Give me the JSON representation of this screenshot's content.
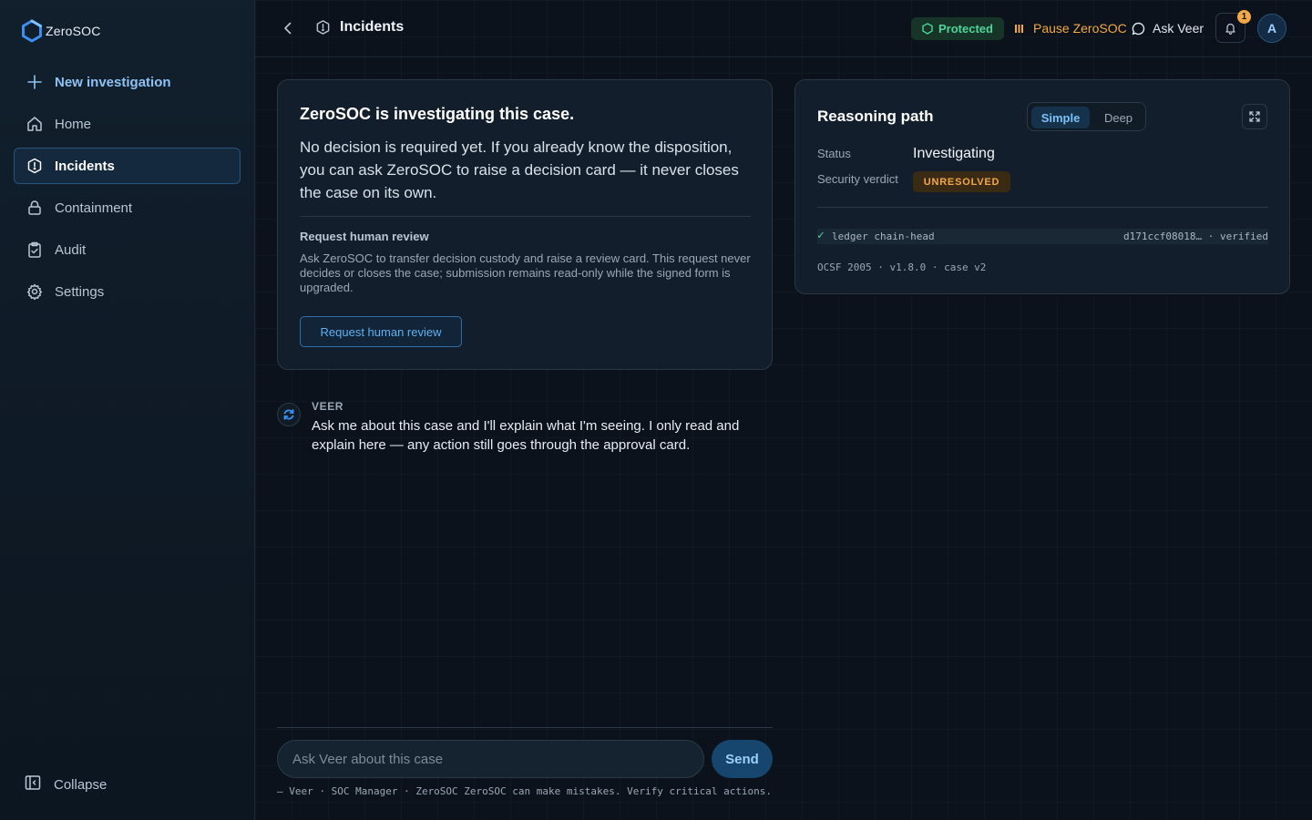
{
  "brand": {
    "name": "ZeroSOC"
  },
  "sidebar": {
    "new_label": "New investigation",
    "items": [
      {
        "label": "Home",
        "icon": "home-icon"
      },
      {
        "label": "Incidents",
        "icon": "shield-icon"
      },
      {
        "label": "Containment",
        "icon": "lock-icon"
      },
      {
        "label": "Audit",
        "icon": "clipboard-check-icon"
      },
      {
        "label": "Settings",
        "icon": "gear-icon"
      }
    ],
    "collapse_label": "Collapse"
  },
  "header": {
    "title": "Incidents",
    "protected_label": "Protected",
    "pause_label": "Pause ZeroSOC",
    "ask_label": "Ask Veer",
    "notification_count": "1",
    "avatar_initial": "A"
  },
  "case": {
    "title": "ZeroSOC is investigating this case.",
    "body": "No decision is required yet. If you already know the disposition, you can ask ZeroSOC to raise a decision card — it never closes the case on its own.",
    "review_title": "Request human review",
    "review_body": "Ask ZeroSOC to transfer decision custody and raise a review card. This request never decides or closes the case; submission remains read-only while the signed form is upgraded.",
    "review_button": "Request human review"
  },
  "reasoning": {
    "title": "Reasoning path",
    "mode_simple": "Simple",
    "mode_deep": "Deep",
    "status_label": "Status",
    "status_value": "Investigating",
    "verdict_label": "Security verdict",
    "verdict_value": "UNRESOLVED",
    "ledger_check": "✓",
    "ledger_name": "ledger chain-head",
    "ledger_hash": "d171ccf08018… · verified",
    "ocsf": "OCSF 2005 · v1.8.0 · case v2"
  },
  "chat": {
    "author": "VEER",
    "message": "Ask me about this case and I'll explain what I'm seeing. I only read and explain here — any action still goes through the approval card.",
    "input_placeholder": "Ask Veer about this case",
    "send_label": "Send",
    "footer": "— Veer · SOC Manager · ZeroSOC ZeroSOC can make mistakes. Verify critical actions."
  },
  "colors": {
    "accent": "#5fb1f2",
    "protected": "#4fd49a",
    "warning": "#f3a846",
    "background": "#0b121b"
  }
}
